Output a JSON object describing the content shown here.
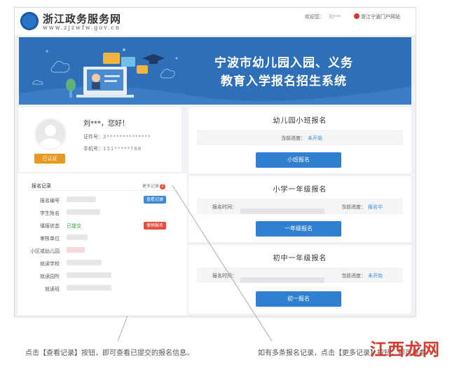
{
  "header": {
    "site_title": "浙江政务服务网",
    "site_url": "www.zjzwfw.gov.cn",
    "welcome": "欢迎您：",
    "user_name": "刘***",
    "portal_link": "浙江宁波门户网站"
  },
  "banner": {
    "title_line1": "宁波市幼儿园入园、义务",
    "title_line2": "教育入学报名招生系统"
  },
  "profile": {
    "greeting": "刘***，您好！",
    "id_label": "证件号：",
    "id_value": "3**************",
    "phone_label": "手机号：",
    "phone_value": "151*****768",
    "auth_button": "已认证"
  },
  "records": {
    "title": "报名记录",
    "more_label": "更多记录",
    "more_count": "2",
    "rows": [
      {
        "label": "报名编号"
      },
      {
        "label": "学生姓名"
      },
      {
        "label": "填报状态",
        "value": "已提交"
      },
      {
        "label": "审核单位"
      },
      {
        "label": "小区或幼儿园"
      },
      {
        "label": "就读学校"
      },
      {
        "label": "就读园所"
      },
      {
        "label": "就读班"
      }
    ],
    "view_button": "查看记录",
    "withdraw_button": "撤销报名"
  },
  "kindergarten": {
    "title": "幼儿园小班报名",
    "status_label": "当前进度：",
    "status_value": "未开始",
    "button": "小班报名"
  },
  "primary": {
    "title": "小学一年级报名",
    "time_label": "报名时间：",
    "status_label": "当前进度：",
    "status_value": "报名中",
    "button": "一年级报名"
  },
  "middle": {
    "title": "初中一年级报名",
    "time_label": "报名时间：",
    "status_label": "当前进度：",
    "status_value": "未开始",
    "button": "初一报名"
  },
  "captions": {
    "left": "点击【查看记录】按钮，即可查看已提交的报名信息。",
    "right": "如有多条报名记录，点击【更多记录】按钮，即可查看"
  },
  "watermark": "江西龙网",
  "colors": {
    "banner": "#2f6fb8",
    "primary_button": "#2f80d0",
    "auth_button": "#e69a23",
    "withdraw": "#e34c3c",
    "success": "#2f9e41"
  }
}
